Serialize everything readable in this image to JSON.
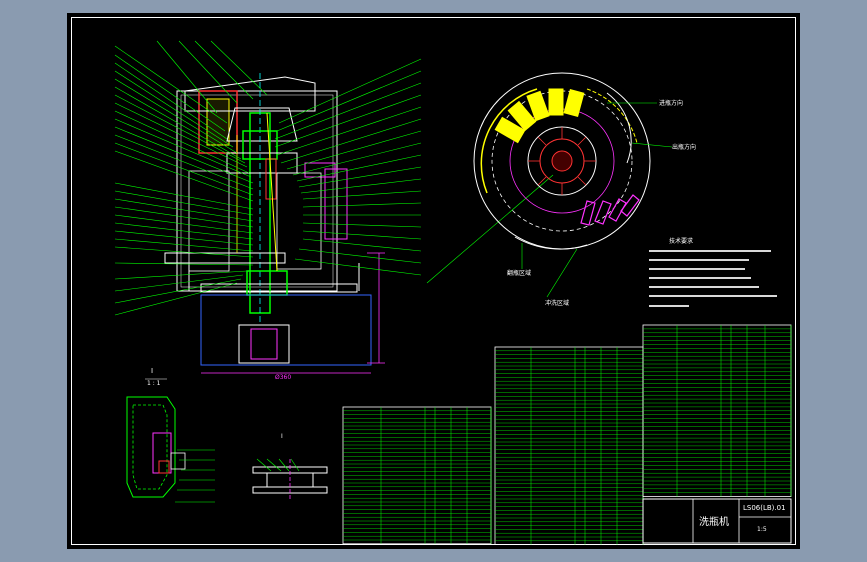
{
  "drawing": {
    "title_block": {
      "product_name": "洗瓶机",
      "drawing_code": "LS06(LB).01",
      "scale_label": "1:5"
    },
    "section_label": "I",
    "section_scale": "1 : 1",
    "detail_label": "Ⅰ",
    "notes_title": "技术要求",
    "rotation_labels": [
      "进瓶方向",
      "出瓶方向",
      "翻瓶区域",
      "冲洗区域"
    ],
    "dimension": "Ø360",
    "colors": {
      "background": "#000000",
      "outline": "#ffffff",
      "leader": "#00ff00",
      "cyan": "#00ffff",
      "magenta": "#ff00ff",
      "yellow": "#ffff00",
      "red": "#ff3333"
    }
  }
}
